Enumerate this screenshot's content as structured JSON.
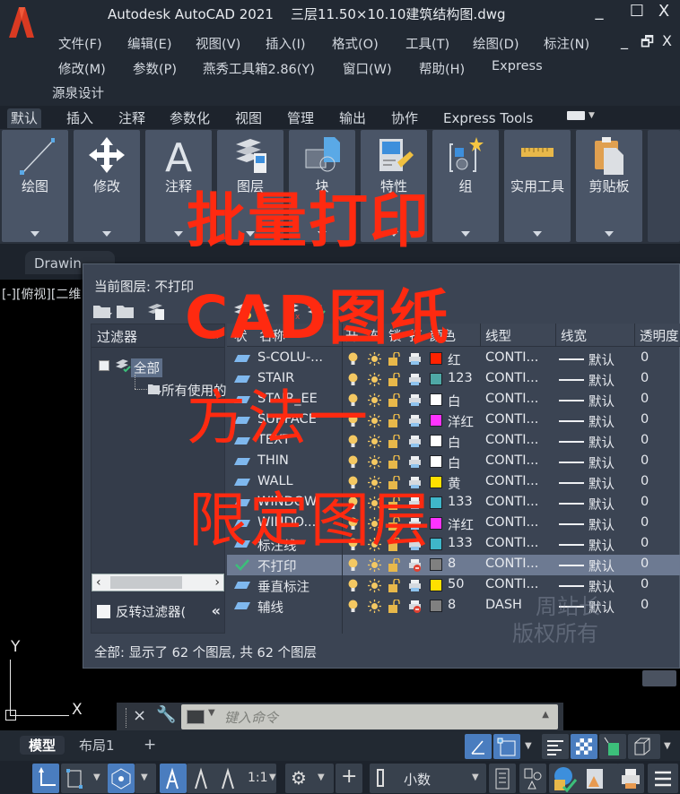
{
  "app": {
    "title": "Autodesk AutoCAD 2021",
    "document": "三层11.50×10.10建筑结构图.dwg",
    "window_controls": {
      "minimize": "_",
      "maximize": "☐",
      "close": "X"
    },
    "mdi_controls": {
      "minimize": "_",
      "restore": "🗗",
      "close": "X"
    }
  },
  "menu": [
    {
      "label": "文件(F)"
    },
    {
      "label": "编辑(E)"
    },
    {
      "label": "视图(V)"
    },
    {
      "label": "插入(I)"
    },
    {
      "label": "格式(O)"
    },
    {
      "label": "工具(T)"
    },
    {
      "label": "绘图(D)"
    },
    {
      "label": "标注(N)"
    },
    {
      "label": "修改(M)"
    },
    {
      "label": "参数(P)"
    },
    {
      "label": "燕秀工具箱2.86(Y)"
    },
    {
      "label": "窗口(W)"
    },
    {
      "label": "帮助(H)"
    },
    {
      "label": "Express"
    },
    {
      "label": "源泉设计"
    }
  ],
  "ribbon_tabs": [
    {
      "label": "默认",
      "active": true
    },
    {
      "label": "插入"
    },
    {
      "label": "注释"
    },
    {
      "label": "参数化"
    },
    {
      "label": "视图"
    },
    {
      "label": "管理"
    },
    {
      "label": "输出"
    },
    {
      "label": "协作"
    },
    {
      "label": "Express Tools"
    }
  ],
  "ribbon_panels": [
    {
      "label": "绘图",
      "icon": "line-icon"
    },
    {
      "label": "修改",
      "icon": "move-icon"
    },
    {
      "label": "注释",
      "icon": "text-icon"
    },
    {
      "label": "图层",
      "icon": "layers-icon"
    },
    {
      "label": "块",
      "icon": "block-icon"
    },
    {
      "label": "特性",
      "icon": "properties-icon"
    },
    {
      "label": "组",
      "icon": "group-icon"
    },
    {
      "label": "实用工具",
      "icon": "ruler-icon"
    },
    {
      "label": "剪贴板",
      "icon": "clipboard-icon"
    }
  ],
  "file_tab": "Drawin",
  "view_label": "[-][俯视][二维",
  "layer_manager": {
    "current_layer_label": "当前图层: 不打印",
    "filters_title": "过滤器",
    "tree": {
      "root": "全部",
      "child": "所有使用的"
    },
    "invert_filter": "反转过滤器(",
    "columns": {
      "status": "状",
      "name": "名称",
      "on": "开",
      "freeze": "冻",
      "lock": "锁",
      "plot": "打",
      "color": "颜色",
      "linetype": "线型",
      "lineweight": "线宽",
      "transparency": "透明度"
    },
    "layers": [
      {
        "name": "S-COLU-...",
        "color": "#ff2200",
        "color_name": "红",
        "linetype": "CONTI...",
        "lineweight": "默认",
        "transparency": "0",
        "plot": true,
        "current": false
      },
      {
        "name": "STAIR",
        "color": "#4fa8a6",
        "color_name": "123",
        "linetype": "CONTI...",
        "lineweight": "默认",
        "transparency": "0",
        "plot": true,
        "current": false
      },
      {
        "name": "STAIR_EE",
        "color": "#ffffff",
        "color_name": "白",
        "linetype": "CONTI...",
        "lineweight": "默认",
        "transparency": "0",
        "plot": true,
        "current": false
      },
      {
        "name": "SURFACE",
        "color": "#ff33ff",
        "color_name": "洋红",
        "linetype": "CONTI...",
        "lineweight": "默认",
        "transparency": "0",
        "plot": true,
        "current": false
      },
      {
        "name": "TEXT",
        "color": "#ffffff",
        "color_name": "白",
        "linetype": "CONTI...",
        "lineweight": "默认",
        "transparency": "0",
        "plot": true,
        "current": false
      },
      {
        "name": "THIN",
        "color": "#ffffff",
        "color_name": "白",
        "linetype": "CONTI...",
        "lineweight": "默认",
        "transparency": "0",
        "plot": true,
        "current": false
      },
      {
        "name": "WALL",
        "color": "#ffe000",
        "color_name": "黄",
        "linetype": "CONTI...",
        "lineweight": "默认",
        "transparency": "0",
        "plot": true,
        "current": false
      },
      {
        "name": "WINDOW",
        "color": "#3fb6c9",
        "color_name": "133",
        "linetype": "CONTI...",
        "lineweight": "默认",
        "transparency": "0",
        "plot": true,
        "current": false
      },
      {
        "name": "WINDO...",
        "color": "#ff33ff",
        "color_name": "洋红",
        "linetype": "CONTI...",
        "lineweight": "默认",
        "transparency": "0",
        "plot": true,
        "current": false
      },
      {
        "name": "标注线",
        "color": "#3fb6c9",
        "color_name": "133",
        "linetype": "CONTI...",
        "lineweight": "默认",
        "transparency": "0",
        "plot": true,
        "current": false
      },
      {
        "name": "不打印",
        "color": "#808080",
        "color_name": "8",
        "linetype": "CONTI...",
        "lineweight": "默认",
        "transparency": "0",
        "plot": false,
        "current": true
      },
      {
        "name": "垂直标注",
        "color": "#ffe000",
        "color_name": "50",
        "linetype": "CONTI...",
        "lineweight": "默认",
        "transparency": "0",
        "plot": true,
        "current": false
      },
      {
        "name": "辅线",
        "color": "#808080",
        "color_name": "8",
        "linetype": "DASH",
        "lineweight": "默认",
        "transparency": "0",
        "plot": false,
        "current": false
      }
    ],
    "status_text": "全部: 显示了 62 个图层, 共 62 个图层"
  },
  "watermark": {
    "line1": "周站长",
    "line2": "版权所有"
  },
  "overlay": {
    "line1": "批量打印",
    "line2": "CAD图纸",
    "line3": "方法一",
    "line4": "限定图层",
    "color": "#ff2a10"
  },
  "command_line": {
    "placeholder": "键入命令"
  },
  "ucs": {
    "x": "X",
    "y": "Y"
  },
  "layout_tabs": [
    {
      "label": "模型",
      "active": true
    },
    {
      "label": "布局1"
    },
    {
      "label": "+"
    }
  ],
  "status_bar": {
    "scale": "1:1",
    "units": "小数"
  }
}
